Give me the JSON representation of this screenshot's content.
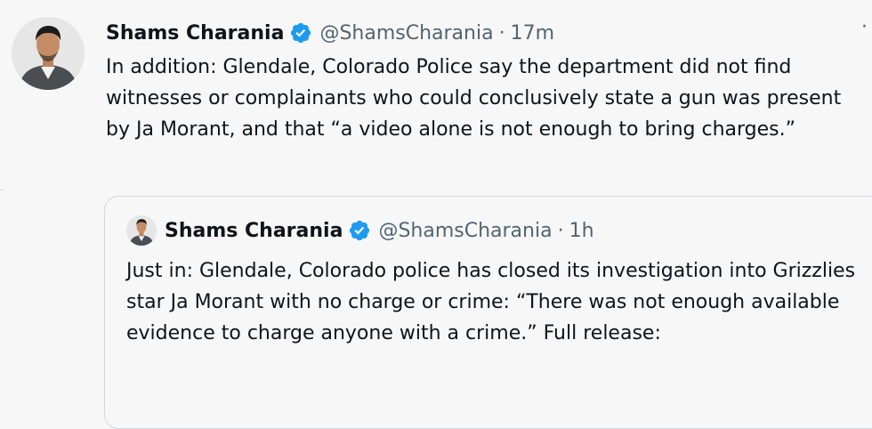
{
  "tweet": {
    "author_name": "Shams Charania",
    "handle": "@ShamsCharania",
    "separator": "·",
    "time": "17m",
    "more": "·",
    "text": "In addition: Glendale, Colorado Police say the department did not find witnesses or complainants who could conclusively state a gun was present by Ja Morant, and that “a video alone is not enough to bring charges.”"
  },
  "quoted_tweet": {
    "author_name": "Shams Charania",
    "handle": "@ShamsCharania",
    "separator": "·",
    "time": "1h",
    "text": "Just in: Glendale, Colorado police has closed its investigation into Grizzlies star Ja Morant with no charge or crime: “There was not enough available evidence to charge anyone with a crime.” Full release:"
  },
  "colors": {
    "background": "#f7f7f7",
    "text": "#0f1419",
    "secondary_text": "#536471",
    "verified_blue": "#1d9bf0",
    "border": "#cfd9de"
  },
  "icons": {
    "verified": "verified-badge-icon",
    "avatar": "profile-photo"
  }
}
